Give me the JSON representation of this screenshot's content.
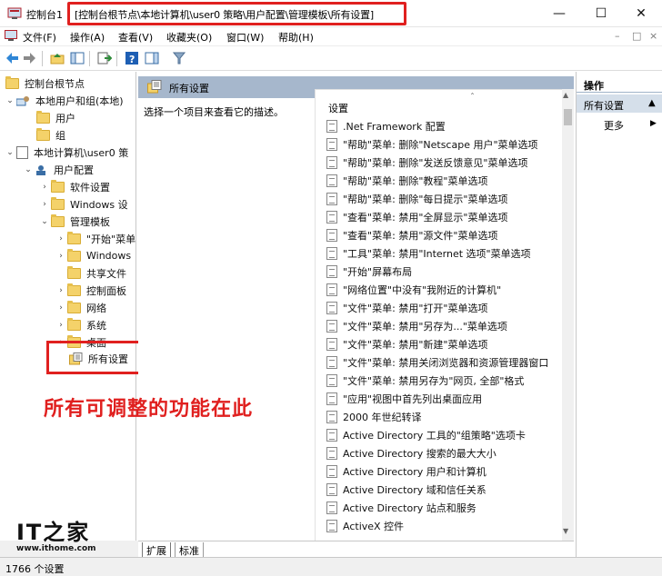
{
  "window": {
    "app_title": "控制台1",
    "path": "[控制台根节点\\本地计算机\\user0 策略\\用户配置\\管理模板\\所有设置]",
    "minimize": "—",
    "maximize": "☐",
    "close": "✕",
    "accent_color": "#e0201f"
  },
  "menu": {
    "items": [
      "文件(F)",
      "操作(A)",
      "查看(V)",
      "收藏夹(O)",
      "窗口(W)",
      "帮助(H)"
    ],
    "mdi": [
      "–",
      "□",
      "×"
    ]
  },
  "toolbar": {
    "icons": [
      "back-arrow-icon",
      "forward-arrow-icon",
      "up-folder-icon",
      "show-hide-tree-icon",
      "export-list-icon",
      "help-icon",
      "show-hide-action-icon",
      "filter-icon"
    ]
  },
  "tree": {
    "items": [
      {
        "label": "控制台根节点",
        "arrow": ""
      },
      {
        "label": "本地用户和组(本地)",
        "arrow": "⌄"
      },
      {
        "label": "用户",
        "arrow": ""
      },
      {
        "label": "组",
        "arrow": ""
      },
      {
        "label": "本地计算机\\user0 策",
        "arrow": "⌄"
      },
      {
        "label": "用户配置",
        "arrow": "⌄"
      },
      {
        "label": "软件设置",
        "arrow": "›"
      },
      {
        "label": "Windows 设",
        "arrow": "›"
      },
      {
        "label": "管理模板",
        "arrow": "⌄"
      },
      {
        "label": "\"开始\"菜单",
        "arrow": "›"
      },
      {
        "label": "Windows",
        "arrow": "›"
      },
      {
        "label": "共享文件",
        "arrow": ""
      },
      {
        "label": "控制面板",
        "arrow": "›"
      },
      {
        "label": "网络",
        "arrow": "›"
      },
      {
        "label": "系统",
        "arrow": "›"
      },
      {
        "label": "桌面",
        "arrow": "›"
      },
      {
        "label": "所有设置",
        "arrow": ""
      }
    ]
  },
  "middle": {
    "header": "所有设置",
    "description": "选择一个项目来查看它的描述。",
    "column_header": "设置",
    "sort_indicator": "ˆ",
    "settings": [
      ".Net Framework 配置",
      "\"帮助\"菜单: 删除\"Netscape 用户\"菜单选项",
      "\"帮助\"菜单: 删除\"发送反馈意见\"菜单选项",
      "\"帮助\"菜单: 删除\"教程\"菜单选项",
      "\"帮助\"菜单: 删除\"每日提示\"菜单选项",
      "\"查看\"菜单: 禁用\"全屏显示\"菜单选项",
      "\"查看\"菜单: 禁用\"源文件\"菜单选项",
      "\"工具\"菜单: 禁用\"Internet 选项\"菜单选项",
      "\"开始\"屏幕布局",
      "\"网络位置\"中没有\"我附近的计算机\"",
      "\"文件\"菜单: 禁用\"打开\"菜单选项",
      "\"文件\"菜单: 禁用\"另存为...\"菜单选项",
      "\"文件\"菜单: 禁用\"新建\"菜单选项",
      "\"文件\"菜单: 禁用关闭浏览器和资源管理器窗口",
      "\"文件\"菜单: 禁用另存为\"网页, 全部\"格式",
      "\"应用\"视图中首先列出桌面应用",
      "2000 年世纪转译",
      "Active Directory 工具的\"组策略\"选项卡",
      "Active Directory 搜索的最大大小",
      "Active Directory 用户和计算机",
      "Active Directory 域和信任关系",
      "Active Directory 站点和服务",
      "ActiveX 控件"
    ]
  },
  "tabs": [
    "扩展",
    "标准"
  ],
  "actions": {
    "header": "操作",
    "selected": "所有设置",
    "more": "更多"
  },
  "annotation": "所有可调整的功能在此",
  "status": "1766 个设置",
  "watermark": {
    "logo": "IT之家",
    "url": "www.ithome.com"
  }
}
